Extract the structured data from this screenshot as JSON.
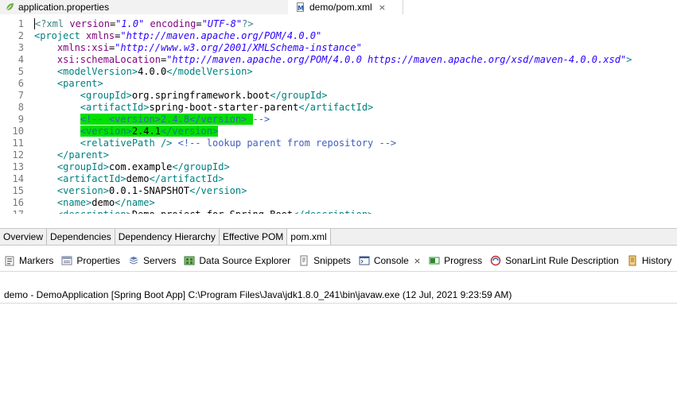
{
  "editor_tabs": [
    {
      "label": "application.properties",
      "icon": "spring-leaf-icon",
      "active": false
    },
    {
      "label": "demo/pom.xml",
      "icon": "maven-file-icon",
      "active": true,
      "close": "⨯"
    }
  ],
  "code_lines": [
    {
      "num": "1",
      "html_key": "l1"
    },
    {
      "num": "2",
      "html_key": "l2"
    },
    {
      "num": "3",
      "html_key": "l3"
    },
    {
      "num": "4",
      "html_key": "l4"
    },
    {
      "num": "5",
      "html_key": "l5"
    },
    {
      "num": "6",
      "html_key": "l6"
    },
    {
      "num": "7",
      "html_key": "l7"
    },
    {
      "num": "8",
      "html_key": "l8"
    },
    {
      "num": "9",
      "html_key": "l9"
    },
    {
      "num": "10",
      "html_key": "l10"
    },
    {
      "num": "11",
      "html_key": "l11"
    },
    {
      "num": "12",
      "html_key": "l12"
    },
    {
      "num": "13",
      "html_key": "l13"
    },
    {
      "num": "14",
      "html_key": "l14"
    },
    {
      "num": "15",
      "html_key": "l15"
    },
    {
      "num": "16",
      "html_key": "l16"
    },
    {
      "num": "17",
      "html_key": "l17"
    }
  ],
  "code": {
    "l1": [
      [
        "kw",
        "<?xml "
      ],
      [
        "attr",
        "version"
      ],
      [
        "tx",
        "="
      ],
      [
        "str",
        "\"1.0\""
      ],
      [
        "tx",
        " "
      ],
      [
        "attr",
        "encoding"
      ],
      [
        "tx",
        "="
      ],
      [
        "str",
        "\"UTF-8\""
      ],
      [
        "kw",
        "?>"
      ]
    ],
    "l2": [
      [
        "tg",
        "<project "
      ],
      [
        "attr",
        "xmlns"
      ],
      [
        "tx",
        "="
      ],
      [
        "str",
        "\"http://maven.apache.org/POM/4.0.0\""
      ]
    ],
    "l3": [
      [
        "tx",
        "    "
      ],
      [
        "attr",
        "xmlns:xsi"
      ],
      [
        "tx",
        "="
      ],
      [
        "str",
        "\"http://www.w3.org/2001/XMLSchema-instance\""
      ]
    ],
    "l4": [
      [
        "tx",
        "    "
      ],
      [
        "attr",
        "xsi:schemaLocation"
      ],
      [
        "tx",
        "="
      ],
      [
        "str",
        "\"http://maven.apache.org/POM/4.0.0 https://maven.apache.org/xsd/maven-4.0.0.xsd\""
      ],
      [
        "tg",
        ">"
      ]
    ],
    "l5": [
      [
        "tx",
        "    "
      ],
      [
        "tg",
        "<modelVersion>"
      ],
      [
        "tx",
        "4.0.0"
      ],
      [
        "tg",
        "</modelVersion>"
      ]
    ],
    "l6": [
      [
        "tx",
        "    "
      ],
      [
        "tg",
        "<parent>"
      ]
    ],
    "l7": [
      [
        "tx",
        "        "
      ],
      [
        "tg",
        "<groupId>"
      ],
      [
        "tx",
        "org.springframework.boot"
      ],
      [
        "tg",
        "</groupId>"
      ]
    ],
    "l8": [
      [
        "tx",
        "        "
      ],
      [
        "tg",
        "<artifactId>"
      ],
      [
        "tx",
        "spring-boot-starter-parent"
      ],
      [
        "tg",
        "</artifactId>"
      ]
    ],
    "l9": [
      [
        "tx",
        "        "
      ],
      [
        "cm hl",
        "<!-- <version>2.4.8</version> "
      ],
      [
        "cm",
        "-->"
      ]
    ],
    "l10": [
      [
        "tx",
        "        "
      ],
      [
        "tg hl",
        "<version>"
      ],
      [
        "tx hl",
        "2.4.1"
      ],
      [
        "tg hl",
        "</version>"
      ]
    ],
    "l11": [
      [
        "tx",
        "        "
      ],
      [
        "tg",
        "<relativePath />"
      ],
      [
        "tx",
        " "
      ],
      [
        "cm",
        "<!-- lookup parent from repository -->"
      ]
    ],
    "l12": [
      [
        "tx",
        "    "
      ],
      [
        "tg",
        "</parent>"
      ]
    ],
    "l13": [
      [
        "tx",
        "    "
      ],
      [
        "tg",
        "<groupId>"
      ],
      [
        "tx",
        "com.example"
      ],
      [
        "tg",
        "</groupId>"
      ]
    ],
    "l14": [
      [
        "tx",
        "    "
      ],
      [
        "tg",
        "<artifactId>"
      ],
      [
        "tx",
        "demo"
      ],
      [
        "tg",
        "</artifactId>"
      ]
    ],
    "l15": [
      [
        "tx",
        "    "
      ],
      [
        "tg",
        "<version>"
      ],
      [
        "tx",
        "0.0.1-SNAPSHOT"
      ],
      [
        "tg",
        "</version>"
      ]
    ],
    "l16": [
      [
        "tx",
        "    "
      ],
      [
        "tg",
        "<name>"
      ],
      [
        "tx",
        "demo"
      ],
      [
        "tg",
        "</name>"
      ]
    ],
    "l17": [
      [
        "tx",
        "    "
      ],
      [
        "tg",
        "<description>"
      ],
      [
        "tx",
        "Demo project for Spring Boot"
      ],
      [
        "tg",
        "</description>"
      ]
    ]
  },
  "pom_tabs": [
    "Overview",
    "Dependencies",
    "Dependency Hierarchy",
    "Effective POM",
    "pom.xml"
  ],
  "pom_selected": "pom.xml",
  "views": [
    {
      "label": "Markers",
      "icon": "markers-icon",
      "color": "#6a6a6a"
    },
    {
      "label": "Properties",
      "icon": "properties-icon",
      "color": "#6a7a8a"
    },
    {
      "label": "Servers",
      "icon": "servers-icon",
      "color": "#4a6a9a"
    },
    {
      "label": "Data Source Explorer",
      "icon": "database-icon",
      "color": "#3a7a3a"
    },
    {
      "label": "Snippets",
      "icon": "snippets-icon",
      "color": "#6a6a6a"
    },
    {
      "label": "Console",
      "icon": "console-icon",
      "color": "#3a5a8a",
      "active": true,
      "close": "⨯"
    },
    {
      "label": "Progress",
      "icon": "progress-icon",
      "color": "#2a8a2a"
    },
    {
      "label": "SonarLint Rule Description",
      "icon": "sonarlint-icon",
      "color": "#c03030"
    },
    {
      "label": "History",
      "icon": "history-icon",
      "color": "#c08a20"
    }
  ],
  "console": {
    "launch_text": "demo - DemoApplication [Spring Boot App] C:\\Program Files\\Java\\jdk1.8.0_241\\bin\\javaw.exe  (12 Jul, 2021 9:23:59 AM)"
  }
}
